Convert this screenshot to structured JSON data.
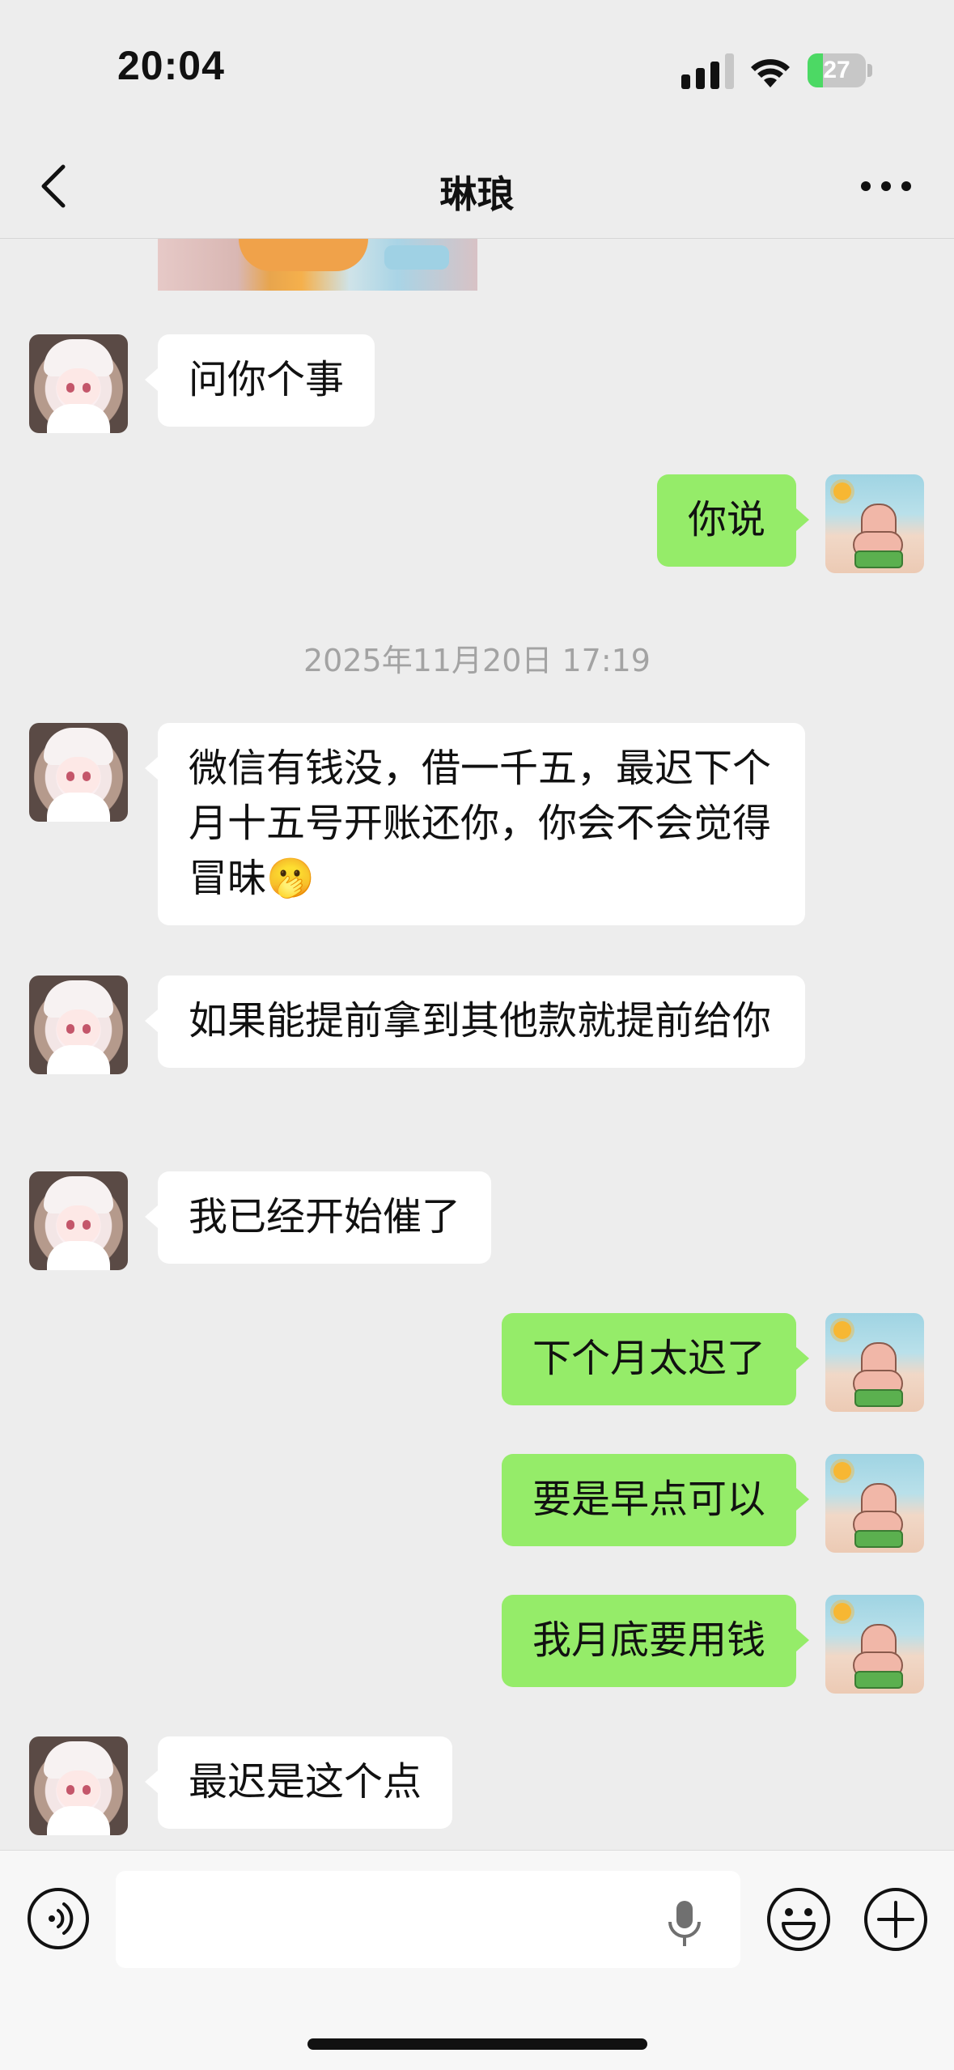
{
  "status_bar": {
    "time": "20:04",
    "battery_text": "27",
    "battery_level": 0.27,
    "icons": [
      "signal-icon",
      "wifi-icon",
      "battery-charging-icon"
    ]
  },
  "nav": {
    "title": "琳琅",
    "back_icon": "chevron-left-icon",
    "more_icon": "more-dots-icon"
  },
  "messages": [
    {
      "side": "left",
      "text": "问你个事"
    },
    {
      "side": "right",
      "text": "你说"
    },
    {
      "side": "left",
      "text": "微信有钱没，借一千五，最迟下个月十五号开账还你，你会不会觉得冒昧🫢"
    },
    {
      "side": "left",
      "text": "如果能提前拿到其他款就提前给你"
    },
    {
      "side": "left",
      "text": "我已经开始催了"
    },
    {
      "side": "right",
      "text": "下个月太迟了"
    },
    {
      "side": "right",
      "text": "要是早点可以"
    },
    {
      "side": "right",
      "text": "我月底要用钱"
    },
    {
      "side": "left",
      "text": "最迟是这个点"
    }
  ],
  "timestamp": "2025年11月20日 17:19",
  "input_bar": {
    "value": "",
    "icons": [
      "voice-icon",
      "mic-icon",
      "emoji-icon",
      "plus-icon"
    ]
  },
  "colors": {
    "background": "#ededed",
    "bubble_mine": "#95ec69",
    "bubble_theirs": "#ffffff",
    "battery": "#4cd964"
  }
}
